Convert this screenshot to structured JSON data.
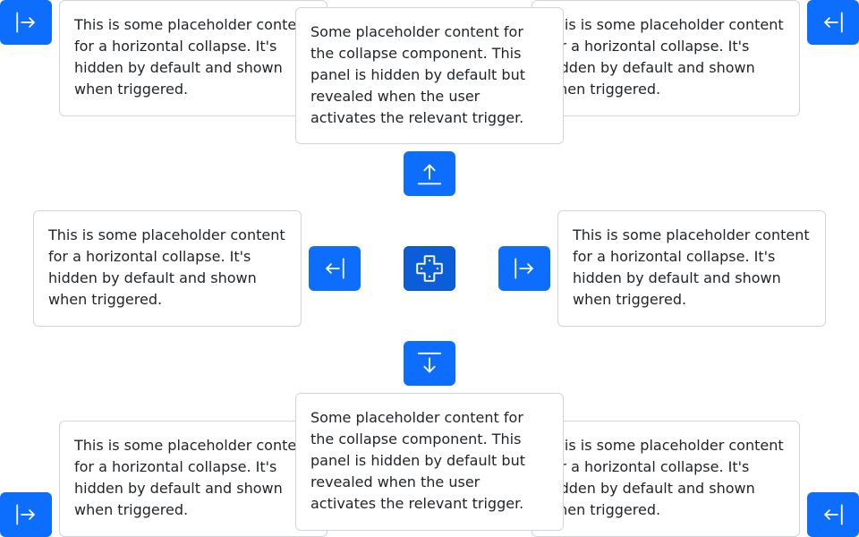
{
  "texts": {
    "horizontal": "This is some placeholder content for a horizontal collapse. It's hidden by default and shown when triggered.",
    "vertical": "Some placeholder content for the collapse component. This panel is hidden by default but revealed when the user activates the relevant trigger."
  },
  "icons": {
    "top_left_button": "arrow-bar-right-icon",
    "top_right_button": "arrow-bar-left-icon",
    "up_button": "arrow-bar-up-icon",
    "left_button": "arrow-bar-left-icon",
    "center_button": "dpad-icon",
    "right_button": "arrow-bar-right-icon",
    "down_button": "arrow-bar-down-icon",
    "bottom_left_button": "arrow-bar-right-icon",
    "bottom_right_button": "arrow-bar-left-icon"
  },
  "colors": {
    "primary": "#0d6efd",
    "primary_active": "#0b5ed7",
    "card_border": "#d0d4d9",
    "text": "#212529"
  }
}
